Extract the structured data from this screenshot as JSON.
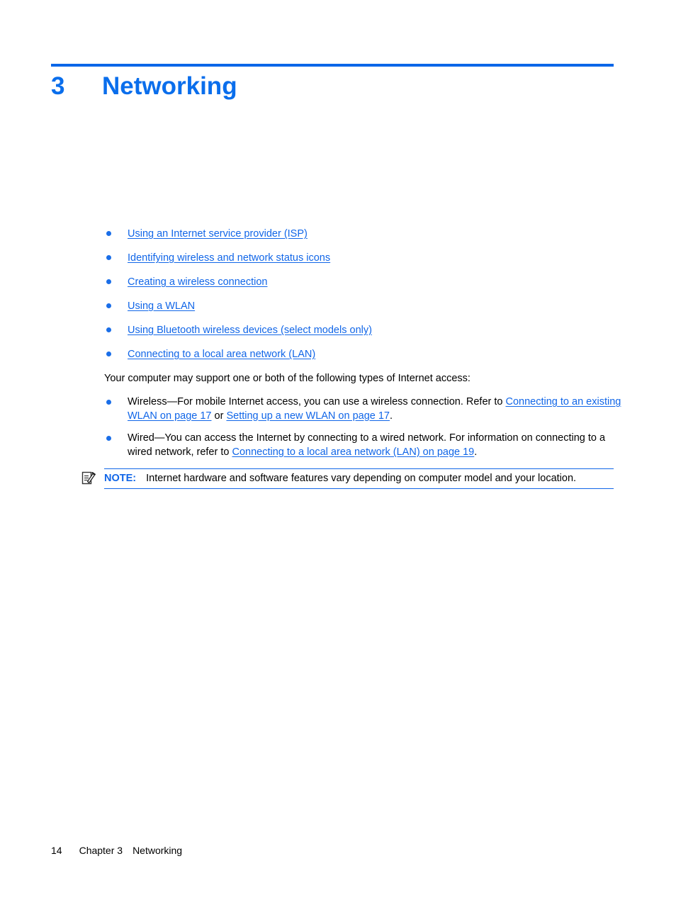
{
  "document": {
    "chapter_number": "3",
    "chapter_title": "Networking",
    "accent_color": "#1166e8",
    "rule_color": "#0a66e8"
  },
  "toc": {
    "items": [
      {
        "label": "Using an Internet service provider (ISP)"
      },
      {
        "label": "Identifying wireless and network status icons"
      },
      {
        "label": "Creating a wireless connection"
      },
      {
        "label": "Using a WLAN"
      },
      {
        "label": "Using Bluetooth wireless devices (select models only)"
      },
      {
        "label": "Connecting to a local area network (LAN)"
      }
    ]
  },
  "body": {
    "intro": "Your computer may support one or both of the following types of Internet access:",
    "bullets": [
      {
        "text_before": "Wireless—For mobile Internet access, you can use a wireless connection. Refer to ",
        "link1": "Connecting to an existing WLAN on page 17",
        "text_middle": " or ",
        "link2": "Setting up a new WLAN on page 17",
        "text_after": "."
      },
      {
        "text_before": "Wired—You can access the Internet by connecting to a wired network. For information on connecting to a wired network, refer to ",
        "link1": "Connecting to a local area network (LAN) on page 19",
        "text_middle": "",
        "link2": "",
        "text_after": "."
      }
    ]
  },
  "note": {
    "icon": "note-pencil-icon",
    "label": "NOTE:",
    "text": "Internet hardware and software features vary depending on computer model and your location."
  },
  "footer": {
    "page_number": "14",
    "chapter_label": "Chapter 3",
    "chapter_name": "Networking"
  }
}
